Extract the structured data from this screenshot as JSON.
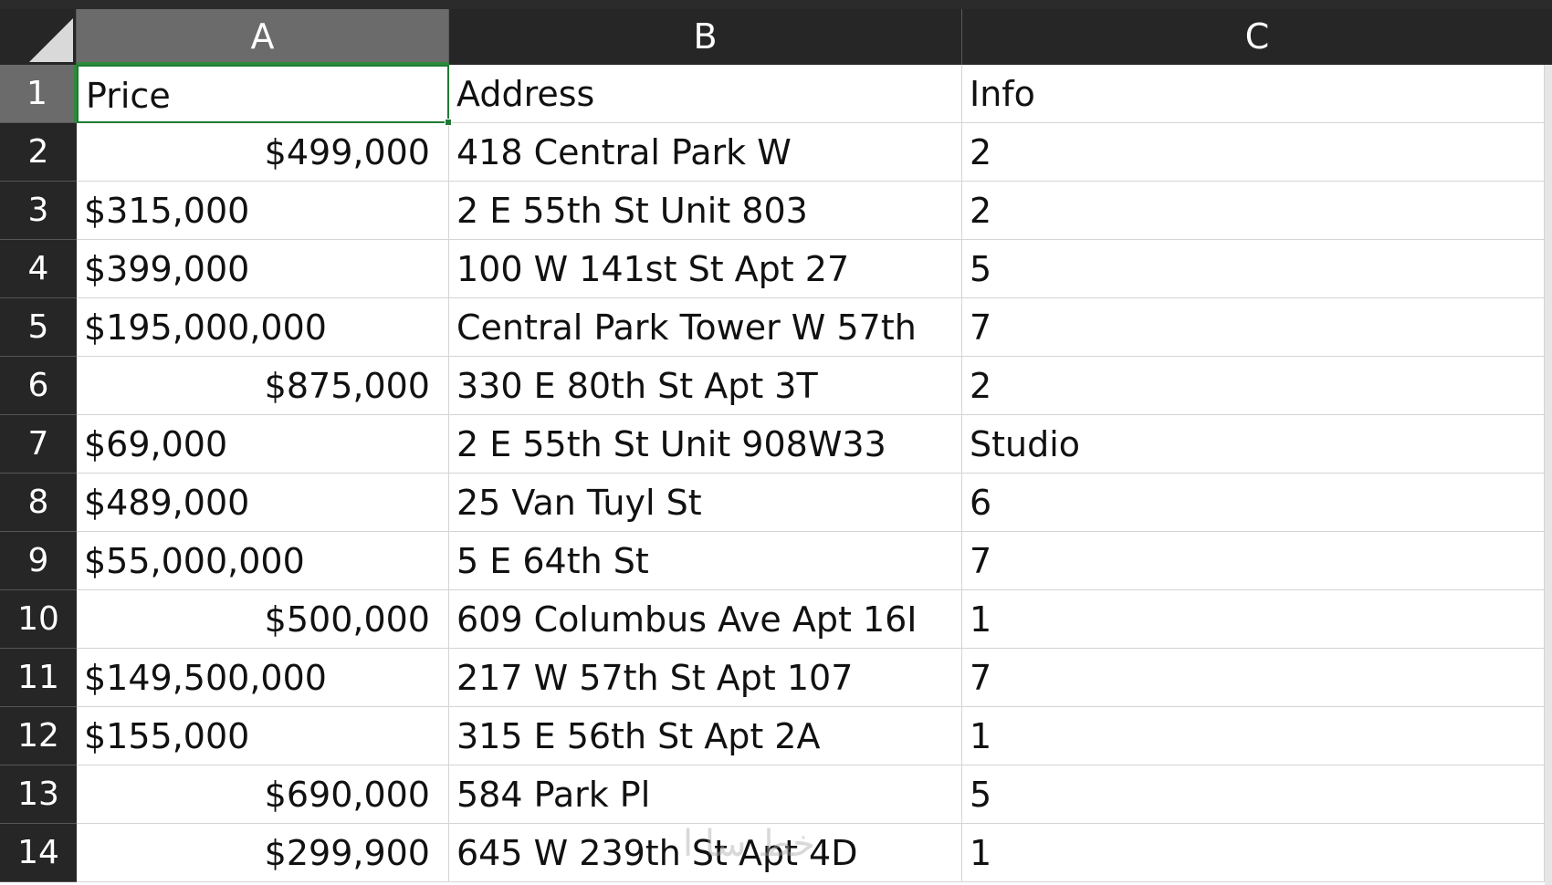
{
  "columns": [
    {
      "letter": "A"
    },
    {
      "letter": "B"
    },
    {
      "letter": "C"
    }
  ],
  "rows": [
    {
      "num": "1",
      "a": "Price",
      "b": "Address",
      "c": "Info",
      "a_align": "left"
    },
    {
      "num": "2",
      "a": "$499,000",
      "b": "418 Central Park W",
      "c": "2",
      "a_align": "right"
    },
    {
      "num": "3",
      "a": "$315,000",
      "b": "2 E 55th St Unit 803",
      "c": "2",
      "a_align": "left"
    },
    {
      "num": "4",
      "a": "$399,000",
      "b": "100 W 141st St Apt 27",
      "c": "5",
      "a_align": "left"
    },
    {
      "num": "5",
      "a": "$195,000,000",
      "b": "Central Park Tower W 57th",
      "c": "7",
      "a_align": "left"
    },
    {
      "num": "6",
      "a": "$875,000",
      "b": "330 E 80th St Apt 3T",
      "c": "2",
      "a_align": "right"
    },
    {
      "num": "7",
      "a": "$69,000",
      "b": "2 E 55th St Unit 908W33",
      "c": "Studio",
      "a_align": "left"
    },
    {
      "num": "8",
      "a": "$489,000",
      "b": "25 Van Tuyl St",
      "c": "6",
      "a_align": "left"
    },
    {
      "num": "9",
      "a": "$55,000,000",
      "b": "5 E 64th St",
      "c": "7",
      "a_align": "left"
    },
    {
      "num": "10",
      "a": "$500,000",
      "b": "609 Columbus Ave Apt 16I",
      "c": "1",
      "a_align": "right"
    },
    {
      "num": "11",
      "a": "$149,500,000",
      "b": "217 W 57th St Apt 107",
      "c": "7",
      "a_align": "left"
    },
    {
      "num": "12",
      "a": "$155,000",
      "b": "315 E 56th St Apt 2A",
      "c": "1",
      "a_align": "left"
    },
    {
      "num": "13",
      "a": "$690,000",
      "b": "584 Park Pl",
      "c": "5",
      "a_align": "right"
    },
    {
      "num": "14",
      "a": "$299,900",
      "b": "645 W 239th St Apt 4D",
      "c": "1",
      "a_align": "right"
    }
  ],
  "active_cell": {
    "col": "A",
    "row": "1"
  },
  "watermark": "خط سا ا",
  "colors": {
    "header_bg": "#262626",
    "selected_header_bg": "#6b6b6b",
    "selection_green": "#1e7b34"
  }
}
